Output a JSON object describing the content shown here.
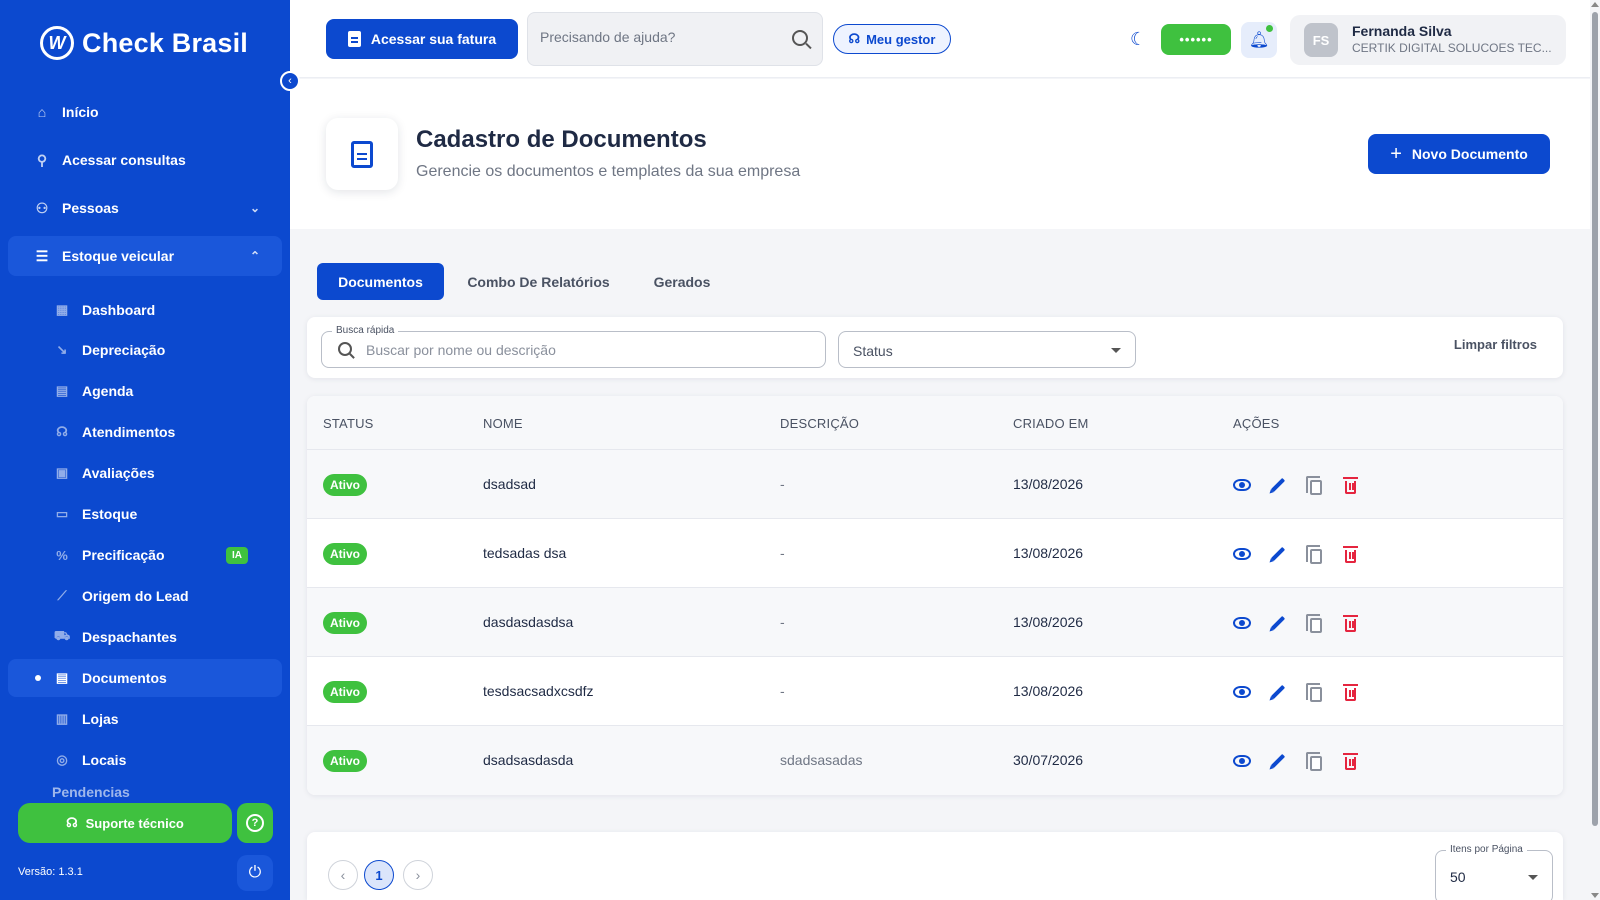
{
  "brand": {
    "name": "Check Brasil",
    "logo_glyph": "W"
  },
  "sidebar": {
    "items": [
      {
        "label": "Início",
        "icon": "home-icon"
      },
      {
        "label": "Acessar consultas",
        "icon": "search-icon"
      },
      {
        "label": "Pessoas",
        "icon": "people-icon"
      },
      {
        "label": "Estoque veicular",
        "icon": "vehicle-stock-icon"
      }
    ],
    "subitems": [
      {
        "label": "Dashboard",
        "icon": "dashboard-icon"
      },
      {
        "label": "Depreciação",
        "icon": "trend-down-icon"
      },
      {
        "label": "Agenda",
        "icon": "calendar-icon"
      },
      {
        "label": "Atendimentos",
        "icon": "headset-icon"
      },
      {
        "label": "Avaliações",
        "icon": "clipboard-icon"
      },
      {
        "label": "Estoque",
        "icon": "car-icon"
      },
      {
        "label": "Precificação",
        "icon": "percent-icon",
        "badge": "IA"
      },
      {
        "label": "Origem do Lead",
        "icon": "chart-line-icon"
      },
      {
        "label": "Despachantes",
        "icon": "truck-icon"
      },
      {
        "label": "Documentos",
        "icon": "document-icon"
      },
      {
        "label": "Lojas",
        "icon": "store-icon"
      },
      {
        "label": "Locais",
        "icon": "pin-icon"
      },
      {
        "label": "Pendencias",
        "icon": "flag-icon"
      }
    ],
    "support_label": "Suporte técnico",
    "version": "Versão: 1.3.1"
  },
  "topbar": {
    "invoice_label": "Acessar sua fatura",
    "help_placeholder": "Precisando de ajuda?",
    "manager_label": "Meu gestor",
    "masked_value": "••••••",
    "user": {
      "initials": "FS",
      "name": "Fernanda Silva",
      "company": "CERTIK DIGITAL SOLUCOES TEC..."
    }
  },
  "page": {
    "title": "Cadastro de Documentos",
    "subtitle": "Gerencie os documentos e templates da sua empresa",
    "new_button": "Novo Documento"
  },
  "tabs": [
    {
      "label": "Documentos",
      "active": true
    },
    {
      "label": "Combo De Relatórios",
      "active": false
    },
    {
      "label": "Gerados",
      "active": false
    }
  ],
  "filters": {
    "search_legend": "Busca rápida",
    "search_placeholder": "Buscar por nome ou descrição",
    "status_label": "Status",
    "clear_label": "Limpar filtros"
  },
  "table": {
    "columns": [
      "STATUS",
      "NOME",
      "DESCRIÇÃO",
      "CRIADO EM",
      "AÇÕES"
    ],
    "rows": [
      {
        "status": "Ativo",
        "name": "dsadsad",
        "description": "-",
        "created": "13/08/2026"
      },
      {
        "status": "Ativo",
        "name": "tedsadas dsa",
        "description": "-",
        "created": "13/08/2026"
      },
      {
        "status": "Ativo",
        "name": "dasdasdasdsa",
        "description": "-",
        "created": "13/08/2026"
      },
      {
        "status": "Ativo",
        "name": "tesdsacsadxcsdfz",
        "description": "-",
        "created": "13/08/2026"
      },
      {
        "status": "Ativo",
        "name": "dsadsasdasda",
        "description": "sdadsasadas",
        "created": "30/07/2026"
      }
    ]
  },
  "pagination": {
    "current_page": "1",
    "prev": "‹",
    "next": "›",
    "per_page_legend": "Itens por Página",
    "per_page_value": "50"
  },
  "colors": {
    "primary": "#0c49cf",
    "success": "#3fc13f",
    "danger": "#e5253f"
  }
}
